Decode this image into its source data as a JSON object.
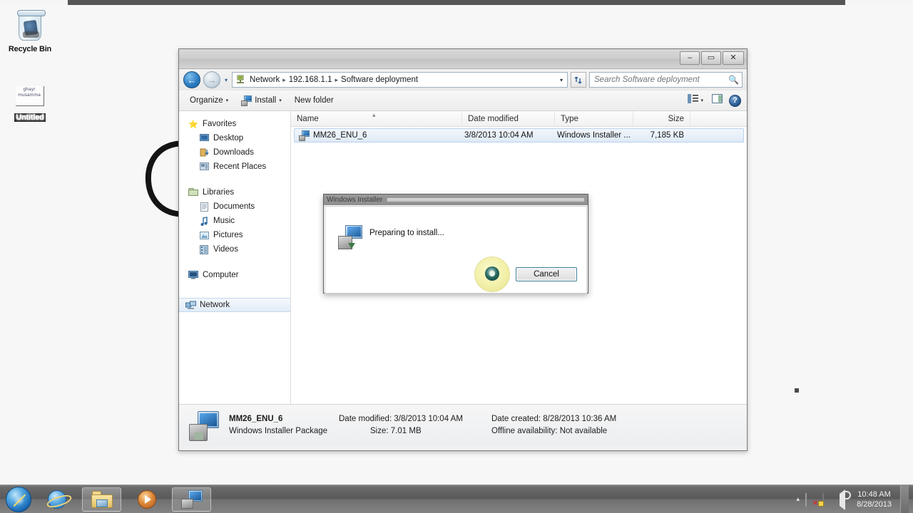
{
  "desktop": {
    "icons": [
      {
        "name": "Recycle Bin",
        "icon": "recycle-bin-icon"
      },
      {
        "name": "Untitled",
        "icon": "sticky-note-icon",
        "note_text": "ghayr\nmusamma"
      }
    ]
  },
  "window": {
    "title": "",
    "caption": {
      "minimize": "–",
      "maximize": "▭",
      "close": "✕"
    },
    "nav": {
      "back_icon": "back-arrow-icon",
      "forward_icon": "forward-arrow-icon",
      "history_caret": "▾",
      "refresh_icon": "↻"
    },
    "address": {
      "location_icon": "network-computer-icon",
      "crumbs": [
        "Network",
        "192.168.1.1",
        "Software deployment"
      ],
      "separator": "▸",
      "dropdown_caret": "▾"
    },
    "search": {
      "placeholder": "Search Software deployment",
      "value": "",
      "icon": "search-magnifier-icon"
    },
    "toolbar": {
      "organize": "Organize",
      "install": "Install",
      "new_folder": "New folder",
      "caret": "▾",
      "view_icon": "view-layout-icon",
      "view_caret": "▾",
      "preview_pane_icon": "preview-pane-icon",
      "help_label": "?"
    }
  },
  "sidebar": {
    "groups": [
      {
        "header": {
          "label": "Favorites",
          "icon": "star-icon"
        },
        "items": [
          {
            "label": "Desktop",
            "icon": "desktop-icon"
          },
          {
            "label": "Downloads",
            "icon": "downloads-icon"
          },
          {
            "label": "Recent Places",
            "icon": "recent-places-icon"
          }
        ]
      },
      {
        "header": {
          "label": "Libraries",
          "icon": "libraries-folder-icon"
        },
        "items": [
          {
            "label": "Documents",
            "icon": "documents-icon"
          },
          {
            "label": "Music",
            "icon": "music-note-icon"
          },
          {
            "label": "Pictures",
            "icon": "pictures-icon"
          },
          {
            "label": "Videos",
            "icon": "videos-icon"
          }
        ]
      },
      {
        "header": {
          "label": "Computer",
          "icon": "computer-icon"
        },
        "items": []
      },
      {
        "header": {
          "label": "Network",
          "icon": "network-icon",
          "selected": true
        },
        "items": []
      }
    ]
  },
  "file_list": {
    "columns": [
      "Name",
      "Date modified",
      "Type",
      "Size"
    ],
    "sort_indicator": "▴",
    "rows": [
      {
        "name": "MM26_ENU_6",
        "date_modified": "3/8/2013 10:04 AM",
        "type": "Windows Installer ...",
        "size": "7,185 KB",
        "icon": "msi-package-icon",
        "selected": true
      }
    ]
  },
  "details_pane": {
    "icon": "msi-package-icon",
    "name": "MM26_ENU_6",
    "type": "Windows Installer Package",
    "fields": [
      {
        "key": "Date modified:",
        "value": "3/8/2013 10:04 AM"
      },
      {
        "key": "Size:",
        "value": "7.01 MB"
      },
      {
        "key": "Date created:",
        "value": "8/28/2013 10:36 AM"
      },
      {
        "key": "Offline availability:",
        "value": "Not available"
      }
    ]
  },
  "dialog": {
    "title": "Windows Installer",
    "message": "Preparing to install...",
    "cancel_label": "Cancel",
    "icon": "installer-package-icon",
    "busy_icon": "busy-disc-cursor-icon"
  },
  "taskbar": {
    "start_icon": "windows-start-orb-icon",
    "buttons": [
      {
        "name": "internet-explorer",
        "icon": "internet-explorer-icon",
        "active": false
      },
      {
        "name": "windows-explorer",
        "icon": "folder-explorer-icon",
        "active": true
      },
      {
        "name": "media-player",
        "icon": "media-player-icon",
        "active": false
      },
      {
        "name": "windows-installer",
        "icon": "installer-package-icon",
        "active": true
      }
    ],
    "tray": {
      "caret": "▴",
      "icons": [
        "action-center-flag-icon",
        "network-icon",
        "volume-speaker-icon"
      ],
      "time": "10:48 AM",
      "date": "8/28/2013"
    }
  }
}
